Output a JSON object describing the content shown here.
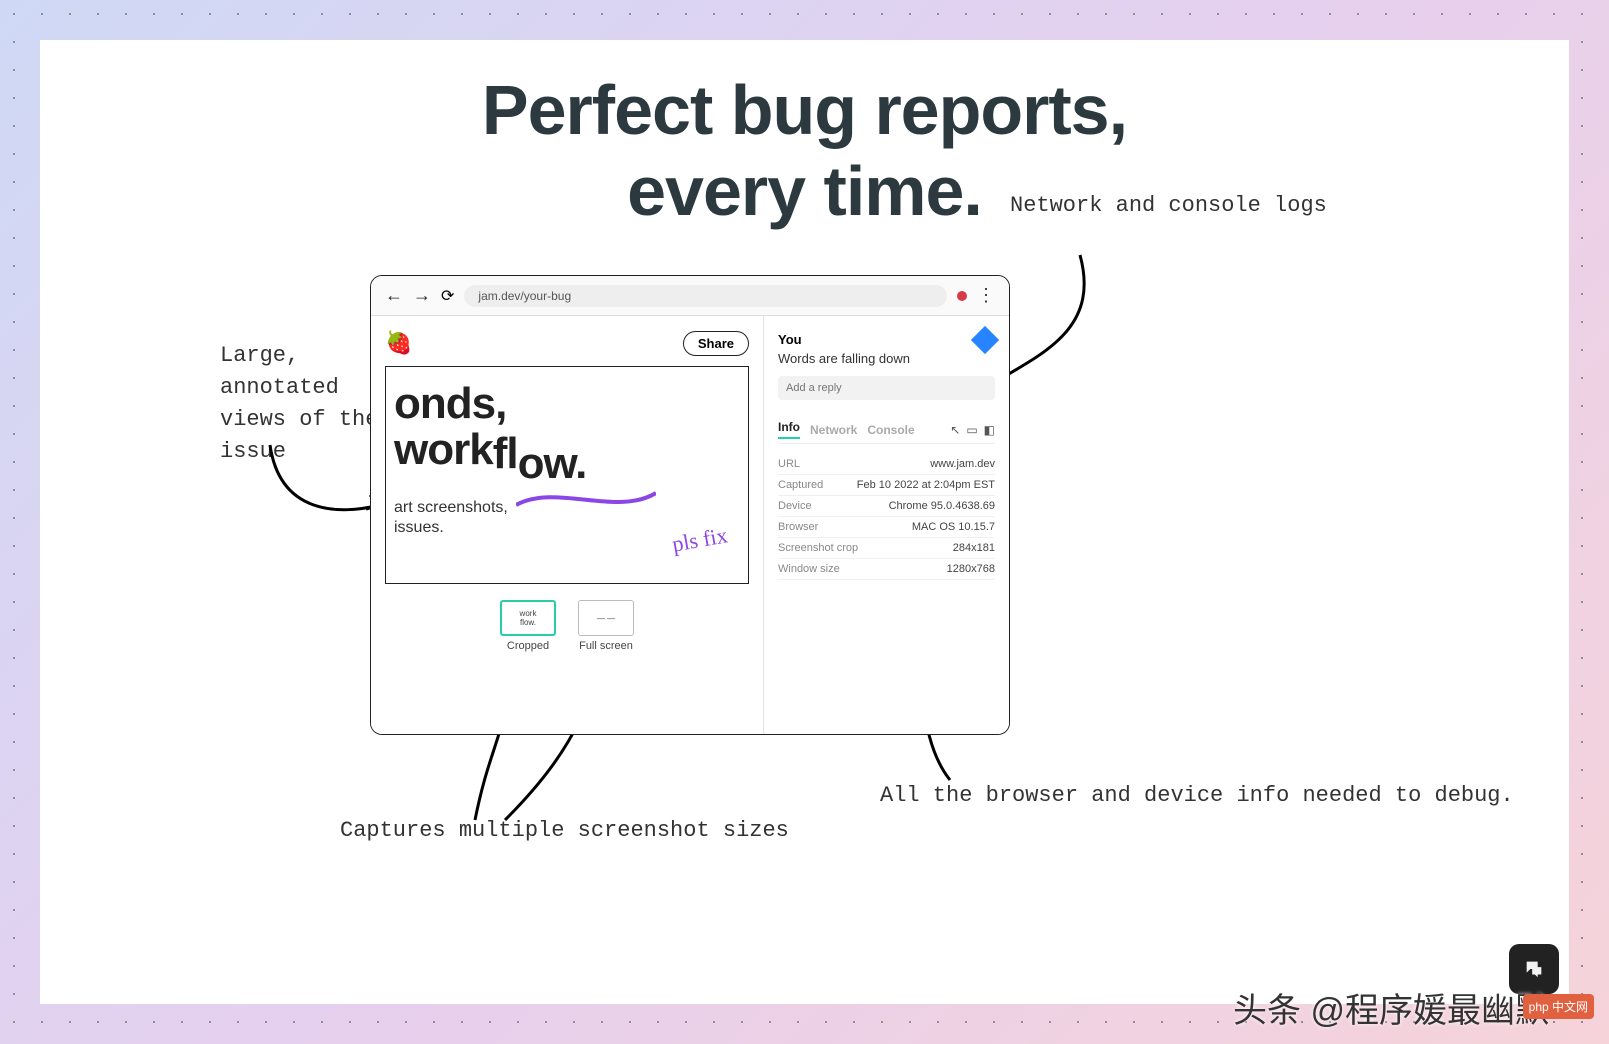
{
  "headline": {
    "line1": "Perfect bug reports,",
    "line2": "every time."
  },
  "annotations": {
    "left": "Large, annotated views of the issue",
    "topright": "Network and console logs",
    "bottomright": "All the browser and device info needed to debug.",
    "bottom": "Captures multiple screenshot sizes"
  },
  "browser": {
    "url": "jam.dev/your-bug",
    "share_label": "Share",
    "screenshot": {
      "big_text_1": "onds,",
      "big_text_2": "workflow.",
      "small_1": "art screenshots,",
      "small_2": "issues.",
      "pls_fix": "pls fix"
    },
    "thumbs": {
      "cropped_label": "Cropped",
      "fullscreen_label": "Full screen"
    },
    "panel": {
      "you": "You",
      "title": "Words are falling down",
      "reply_placeholder": "Add a reply",
      "tabs": {
        "info": "Info",
        "network": "Network",
        "console": "Console"
      },
      "info_rows": [
        {
          "k": "URL",
          "v": "www.jam.dev"
        },
        {
          "k": "Captured",
          "v": "Feb 10 2022 at 2:04pm EST"
        },
        {
          "k": "Device",
          "v": "Chrome 95.0.4638.69"
        },
        {
          "k": "Browser",
          "v": "MAC OS 10.15.7"
        },
        {
          "k": "Screenshot crop",
          "v": "284x181"
        },
        {
          "k": "Window size",
          "v": "1280x768"
        }
      ]
    }
  },
  "watermark": "头条 @程序媛最幽默",
  "wm_badge": "php 中文网"
}
